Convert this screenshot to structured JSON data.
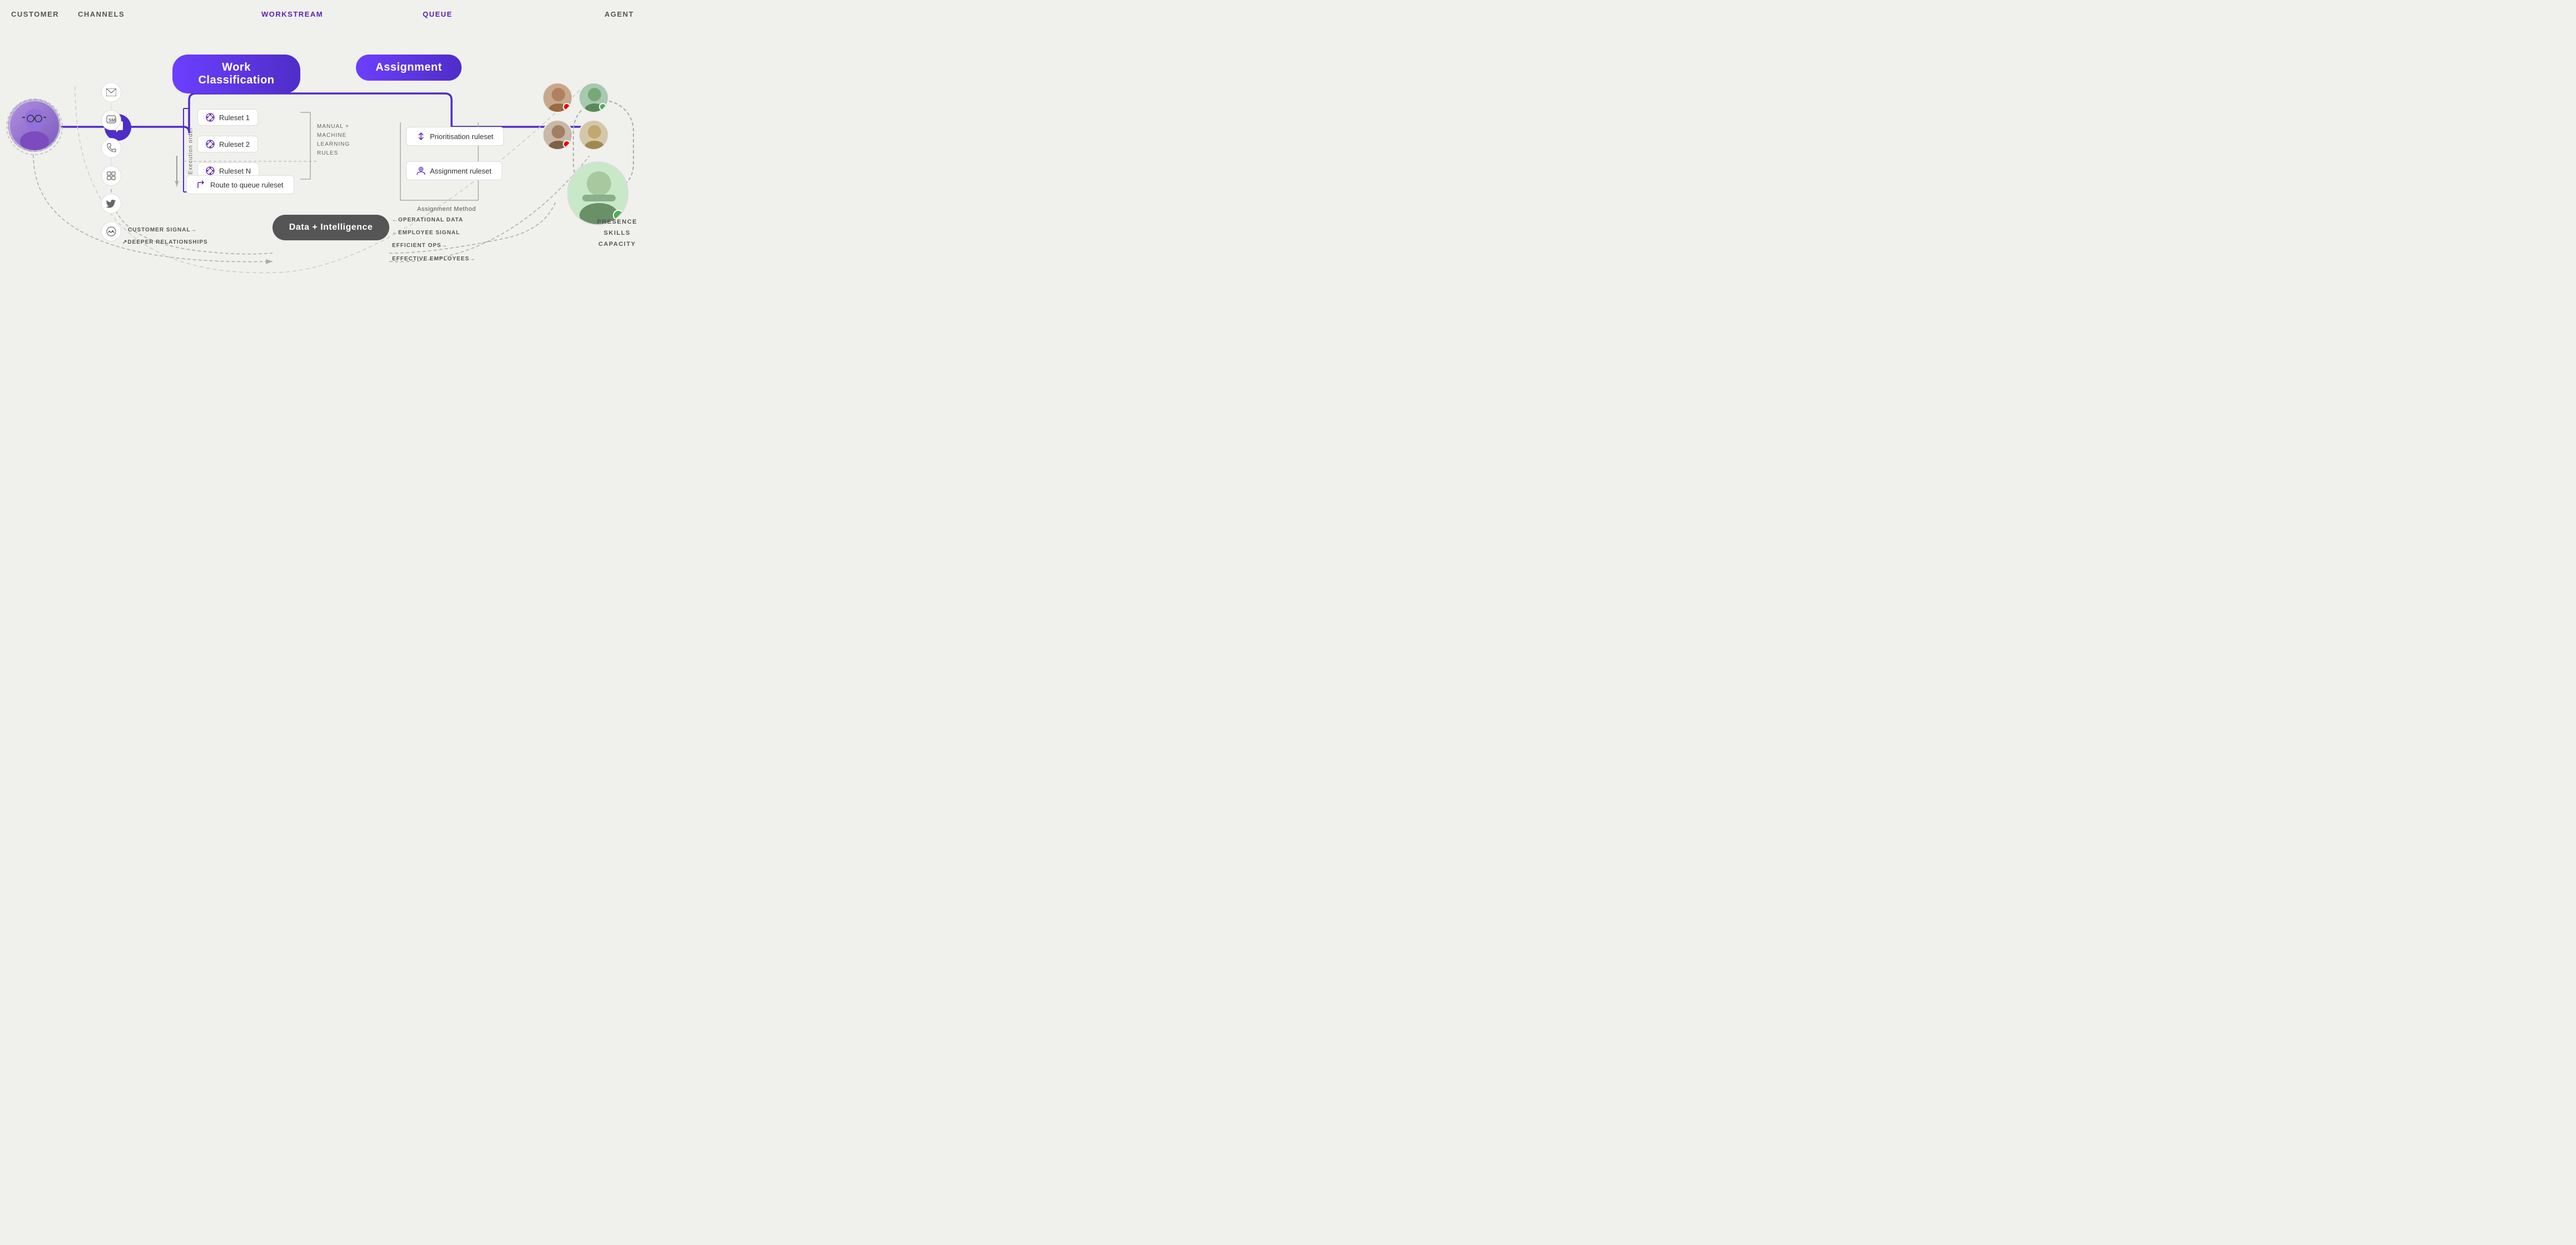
{
  "header": {
    "customer_label": "CUSTOMER",
    "channels_label": "CHANNELS",
    "workstream_label": "WORKSTREAM",
    "queue_label": "QUEUE",
    "agent_label": "AGENT"
  },
  "badges": {
    "work_classification": "Work Classification",
    "assignment": "Assignment",
    "data_intelligence": "Data + Intelligence"
  },
  "rulesets": [
    {
      "label": "Ruleset 1"
    },
    {
      "label": "Ruleset 2"
    },
    {
      "label": "Ruleset N"
    }
  ],
  "ml_rules": {
    "line1": "MANUAL +",
    "line2": "MACHINE",
    "line3": "LEARNING",
    "line4": "RULES"
  },
  "assignment_boxes": [
    {
      "icon": "sort-icon",
      "label": "Prioritisation ruleset"
    },
    {
      "icon": "person-icon",
      "label": "Assignment ruleset"
    }
  ],
  "assignment_method": "Assignment Method",
  "route_to_queue": "Route to queue ruleset",
  "execution_order": "Execution order",
  "flow_labels_left": [
    "CUSTOMER SIGNAL→",
    "↗DEEPER RELATIONSHIPS"
  ],
  "flow_labels_right": [
    "←OPERATIONAL DATA",
    "←EMPLOYEE SIGNAL",
    "EFFICIENT OPS→",
    "EFFECTIVE EMPLOYEES→"
  ],
  "presence_text": "PRESENCE\nSKILLS\nCAPACITY",
  "colors": {
    "purple": "#5b21b6",
    "purple_dark": "#4f2dc7",
    "purple_bright": "#6c3fff",
    "gray_text": "#555555",
    "border_gray": "#cccccc",
    "bg": "#f0f0ed"
  }
}
